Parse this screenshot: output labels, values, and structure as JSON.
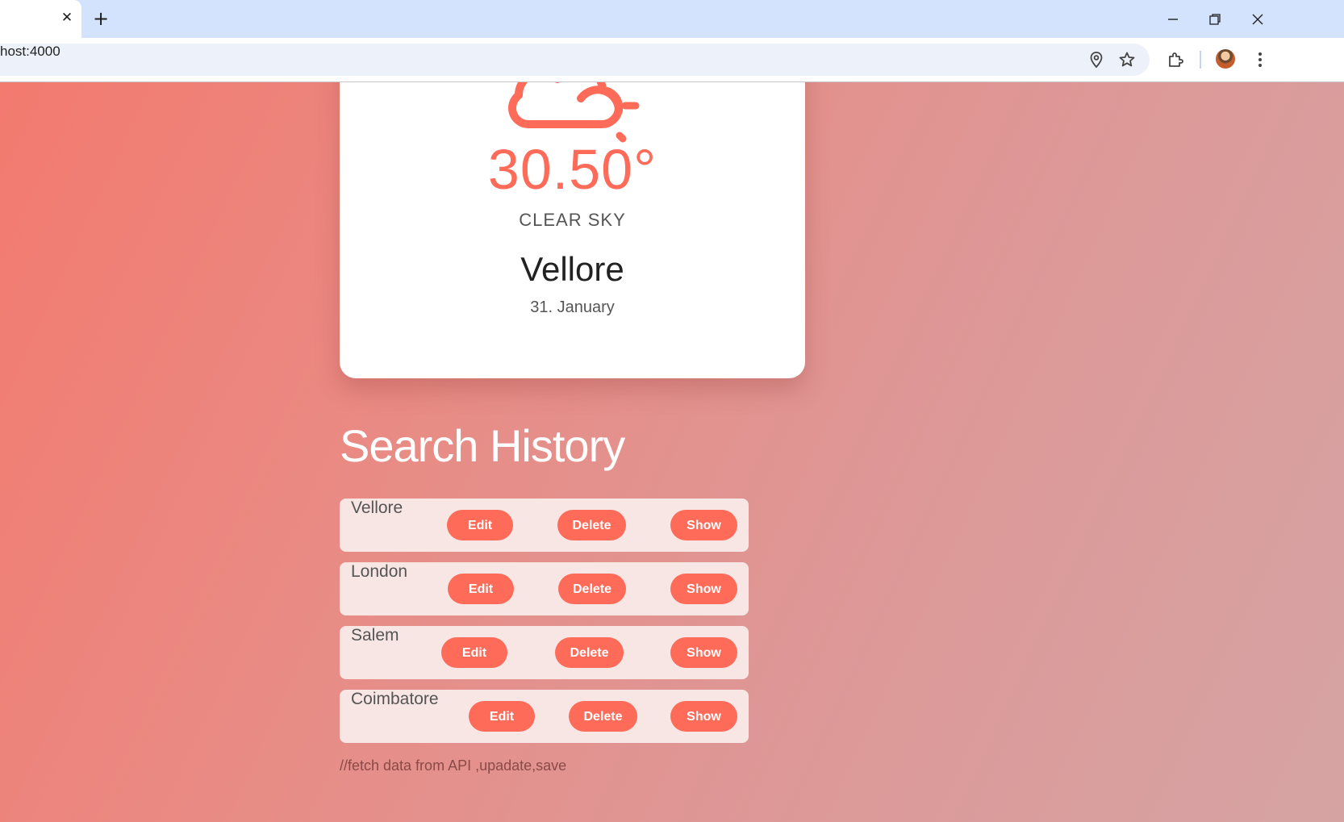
{
  "browser": {
    "tab_close_icon": "close-icon",
    "new_tab_label": "+",
    "url": "host:4000",
    "icons": [
      "location-pin-icon",
      "star-icon",
      "extensions-icon",
      "more-vert-icon"
    ]
  },
  "weather": {
    "icon": "cloud-sun-icon",
    "temperature": "30.50°",
    "condition": "CLEAR SKY",
    "city": "Vellore",
    "date": "31. January"
  },
  "history": {
    "title": "Search History",
    "edit_label": "Edit",
    "delete_label": "Delete",
    "show_label": "Show",
    "items": [
      {
        "city": "Vellore"
      },
      {
        "city": "London"
      },
      {
        "city": "Salem"
      },
      {
        "city": "Coimbatore"
      }
    ]
  },
  "comment": "//fetch data from API ,upadate,save",
  "colors": {
    "accent": "#fe6b59",
    "tabstrip": "#d3e3fd"
  }
}
